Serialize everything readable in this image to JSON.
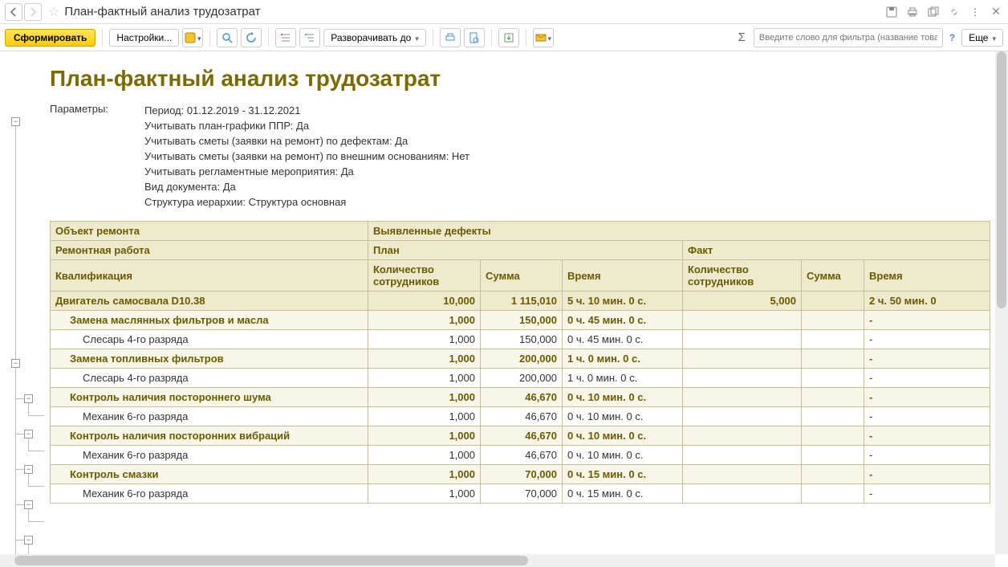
{
  "title": "План-фактный анализ трудозатрат",
  "toolbar": {
    "generate": "Сформировать",
    "settings": "Настройки...",
    "expand_to": "Разворачивать до",
    "more": "Еще",
    "filter_placeholder": "Введите слово для фильтра (название товара, покупателя и п..."
  },
  "report": {
    "title": "План-фактный анализ трудозатрат",
    "params_label": "Параметры:",
    "params": [
      "Период: 01.12.2019 - 31.12.2021",
      "Учитывать план-графики ППР: Да",
      "Учитывать сметы (заявки на ремонт) по дефектам: Да",
      "Учитывать сметы (заявки на ремонт) по внешним основаниям: Нет",
      "Учитывать регламентные мероприятия: Да",
      "Вид документа: Да",
      "Структура иерархии: Структура основная"
    ],
    "headers": {
      "object": "Объект ремонта",
      "defects": "Выявленные дефекты",
      "work": "Ремонтная работа",
      "plan": "План",
      "fact": "Факт",
      "qual": "Квалификация",
      "qty": "Количество сотрудников",
      "sum": "Сумма",
      "time": "Время"
    },
    "group": {
      "name": "Двигатель самосвала D10.38",
      "plan_qty": "10,000",
      "plan_sum": "1 115,010",
      "plan_time": "5 ч. 10 мин. 0 с.",
      "fact_qty": "5,000",
      "fact_sum": "",
      "fact_time": "2 ч. 50 мин. 0"
    },
    "rows": [
      {
        "type": "work",
        "name": "Замена маслянных фильтров и масла",
        "pq": "1,000",
        "ps": "150,000",
        "pt": "0 ч. 45 мин. 0 с.",
        "fq": "",
        "fs": "",
        "ft": "-"
      },
      {
        "type": "detail",
        "name": "Слесарь 4-го разряда",
        "pq": "1,000",
        "ps": "150,000",
        "pt": "0 ч. 45 мин. 0 с.",
        "fq": "",
        "fs": "",
        "ft": "-"
      },
      {
        "type": "work",
        "name": "Замена топливных фильтров",
        "pq": "1,000",
        "ps": "200,000",
        "pt": "1 ч. 0 мин. 0 с.",
        "fq": "",
        "fs": "",
        "ft": "-"
      },
      {
        "type": "detail",
        "name": "Слесарь 4-го разряда",
        "pq": "1,000",
        "ps": "200,000",
        "pt": "1 ч. 0 мин. 0 с.",
        "fq": "",
        "fs": "",
        "ft": "-"
      },
      {
        "type": "work",
        "name": "Контроль наличия постороннего шума",
        "pq": "1,000",
        "ps": "46,670",
        "pt": "0 ч. 10 мин. 0 с.",
        "fq": "",
        "fs": "",
        "ft": "-"
      },
      {
        "type": "detail",
        "name": "Механик 6-го разряда",
        "pq": "1,000",
        "ps": "46,670",
        "pt": "0 ч. 10 мин. 0 с.",
        "fq": "",
        "fs": "",
        "ft": "-"
      },
      {
        "type": "work",
        "name": "Контроль наличия посторонних вибраций",
        "pq": "1,000",
        "ps": "46,670",
        "pt": "0 ч. 10 мин. 0 с.",
        "fq": "",
        "fs": "",
        "ft": "-"
      },
      {
        "type": "detail",
        "name": "Механик 6-го разряда",
        "pq": "1,000",
        "ps": "46,670",
        "pt": "0 ч. 10 мин. 0 с.",
        "fq": "",
        "fs": "",
        "ft": "-"
      },
      {
        "type": "work",
        "name": "Контроль смазки",
        "pq": "1,000",
        "ps": "70,000",
        "pt": "0 ч. 15 мин. 0 с.",
        "fq": "",
        "fs": "",
        "ft": "-"
      },
      {
        "type": "detail",
        "name": "Механик 6-го разряда",
        "pq": "1,000",
        "ps": "70,000",
        "pt": "0 ч. 15 мин. 0 с.",
        "fq": "",
        "fs": "",
        "ft": "-"
      }
    ]
  }
}
